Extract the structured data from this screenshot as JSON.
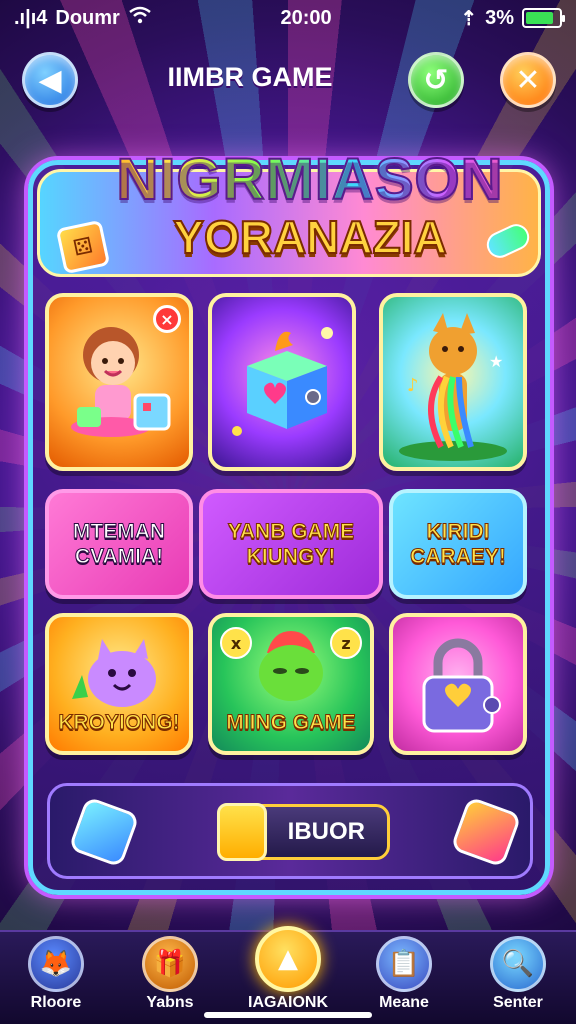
{
  "status_bar": {
    "carrier": "Doumr",
    "signal": ".ı|ı4",
    "time": "20:00",
    "right_text": "3%",
    "arrow": "⇡",
    "battery_level": 0.85
  },
  "top_bar": {
    "title": "IIMBR GAME",
    "back_icon": "back-arrow-icon",
    "green_icon": "refresh-icon",
    "close_icon": "close-icon"
  },
  "banner": {
    "title": "NIGRMIASON",
    "subtitle": "YORANAZIA"
  },
  "cards_row1": [
    {
      "art": "girl-with-gift"
    },
    {
      "art": "magic-cube"
    },
    {
      "art": "rainbow-fox"
    }
  ],
  "cards_row2": [
    {
      "line1": "MTEMAN",
      "line2": "CVAMIA!"
    },
    {
      "line1": "YANB GAME",
      "line2": "KIUNGY!"
    },
    {
      "line1": "KIRIDI",
      "line2": "CARAEY!"
    }
  ],
  "cards_row3": [
    {
      "label": "KROYIONG!"
    },
    {
      "label": "MIING GAME"
    },
    {
      "label": ""
    }
  ],
  "card_badges": {
    "x_badge": "×",
    "left_mini": "x",
    "right_mini": "z"
  },
  "bottom_strip": {
    "button_label": "IBUOR"
  },
  "nav": [
    {
      "label": "Rloore",
      "icon": "fox-icon"
    },
    {
      "label": "Yabns",
      "icon": "gift-box-icon"
    },
    {
      "label": "IAGAIONK",
      "icon": "home-arrow-icon"
    },
    {
      "label": "Meane",
      "icon": "notebook-icon"
    },
    {
      "label": "Senter",
      "icon": "search-icon"
    }
  ],
  "colors": {
    "accent_gold": "#ffce3a",
    "panel_border": "#5fd8ff",
    "background": "#2a0e5a"
  }
}
